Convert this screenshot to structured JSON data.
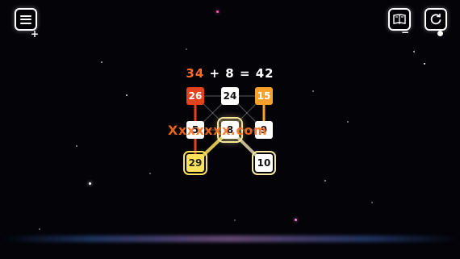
{
  "hud": {
    "menu_icon": "hamburger-menu-icon",
    "menu_badge": "+",
    "book_icon": "book-icon",
    "book_badge": "−",
    "restart_icon": "restart-icon"
  },
  "equation": {
    "first": "34",
    "rest": " + 8 = 42"
  },
  "board": {
    "tiles": [
      {
        "value": "26",
        "style": "red"
      },
      {
        "value": "24",
        "style": "white"
      },
      {
        "value": "15",
        "style": "orange"
      },
      {
        "value": "5",
        "style": "white"
      },
      {
        "value": "8",
        "style": "center-selected"
      },
      {
        "value": "9",
        "style": "white"
      },
      {
        "value": "29",
        "style": "yellow-selected"
      },
      {
        "value": "10",
        "style": "white-selected"
      }
    ]
  },
  "watermark": "Xxxxxxx.com",
  "colors": {
    "background": "#030308",
    "accent_orange": "#ff6a2a",
    "tile_red": "#e2431e",
    "tile_orange": "#f7a02c",
    "tile_yellow": "#fde25b"
  }
}
